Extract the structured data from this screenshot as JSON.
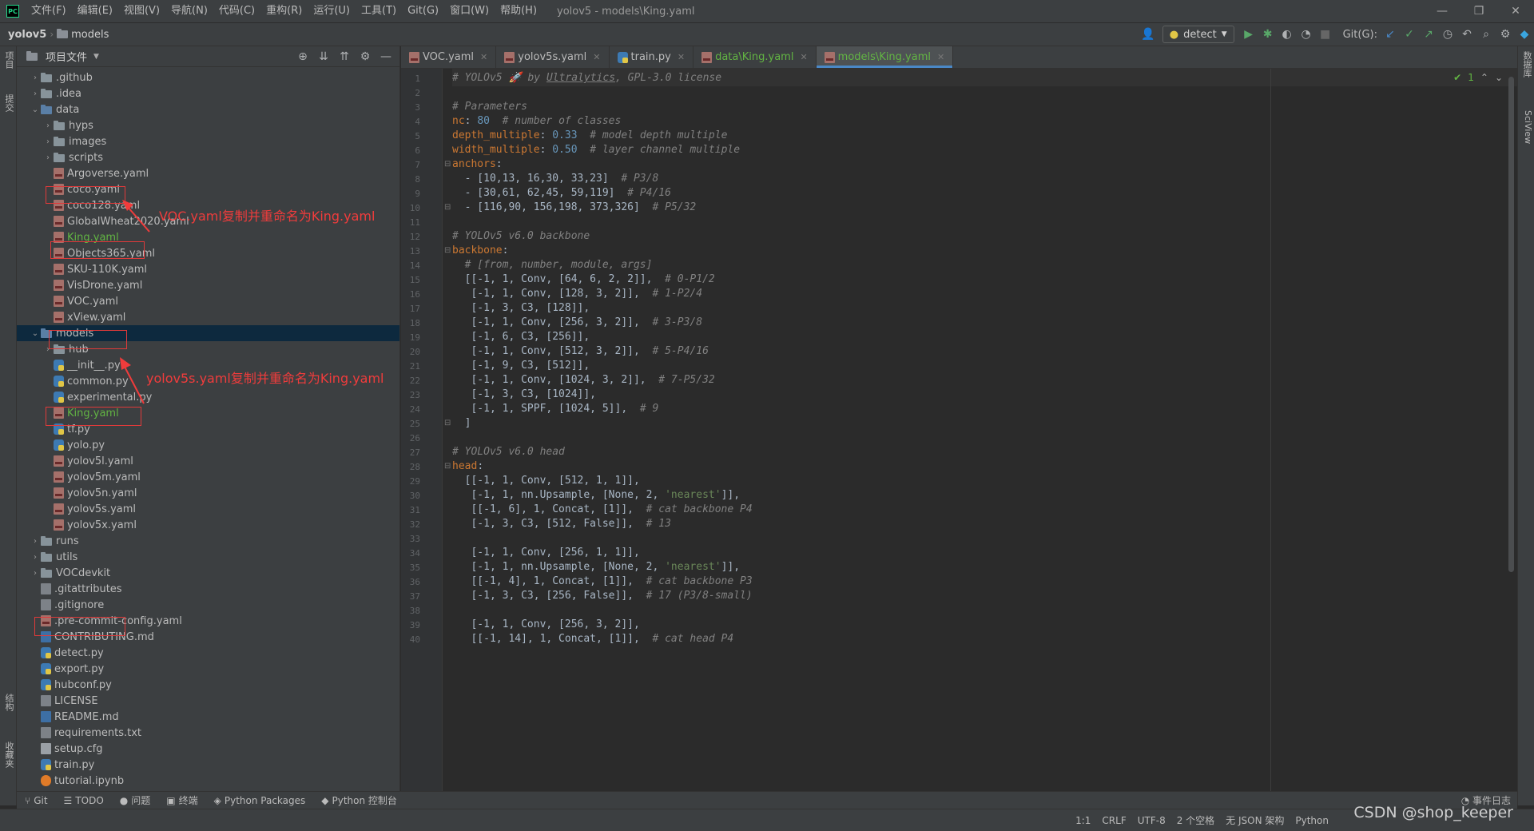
{
  "app": {
    "logo": "PC",
    "window_title": "yolov5 - models\\King.yaml"
  },
  "menu": [
    "文件(F)",
    "编辑(E)",
    "视图(V)",
    "导航(N)",
    "代码(C)",
    "重构(R)",
    "运行(U)",
    "工具(T)",
    "Git(G)",
    "窗口(W)",
    "帮助(H)"
  ],
  "window_controls": {
    "minimize": "—",
    "restore": "❐",
    "close": "✕"
  },
  "breadcrumb": {
    "project": "yolov5",
    "separator": "›",
    "folder": "models"
  },
  "toolbar": {
    "run_config": "detect",
    "git_label": "Git(G):"
  },
  "left_stripe": {
    "project": "项目",
    "commit": "提交",
    "structure": "结构",
    "favorites": "收藏夹"
  },
  "right_stripe": {
    "database": "数据库",
    "sciview": "SciView"
  },
  "project_panel": {
    "title": "项目文件"
  },
  "tree": [
    {
      "name": ".github",
      "type": "dir",
      "depth": 1,
      "expanded": false
    },
    {
      "name": ".idea",
      "type": "dir",
      "depth": 1,
      "expanded": false
    },
    {
      "name": "data",
      "type": "dir",
      "depth": 1,
      "expanded": true
    },
    {
      "name": "hyps",
      "type": "dir",
      "depth": 2,
      "expanded": false
    },
    {
      "name": "images",
      "type": "dir",
      "depth": 2,
      "expanded": false
    },
    {
      "name": "scripts",
      "type": "dir",
      "depth": 2,
      "expanded": false
    },
    {
      "name": "Argoverse.yaml",
      "type": "yaml",
      "depth": 2
    },
    {
      "name": "coco.yaml",
      "type": "yaml",
      "depth": 2
    },
    {
      "name": "coco128.yaml",
      "type": "yaml",
      "depth": 2
    },
    {
      "name": "GlobalWheat2020.yaml",
      "type": "yaml",
      "depth": 2
    },
    {
      "name": "King.yaml",
      "type": "yaml",
      "depth": 2,
      "new": true
    },
    {
      "name": "Objects365.yaml",
      "type": "yaml",
      "depth": 2
    },
    {
      "name": "SKU-110K.yaml",
      "type": "yaml",
      "depth": 2
    },
    {
      "name": "VisDrone.yaml",
      "type": "yaml",
      "depth": 2
    },
    {
      "name": "VOC.yaml",
      "type": "yaml",
      "depth": 2
    },
    {
      "name": "xView.yaml",
      "type": "yaml",
      "depth": 2
    },
    {
      "name": "models",
      "type": "dir",
      "depth": 1,
      "expanded": true,
      "selected": true
    },
    {
      "name": "hub",
      "type": "dir",
      "depth": 2,
      "expanded": false
    },
    {
      "name": "__init__.py",
      "type": "py",
      "depth": 2
    },
    {
      "name": "common.py",
      "type": "py",
      "depth": 2
    },
    {
      "name": "experimental.py",
      "type": "py",
      "depth": 2
    },
    {
      "name": "King.yaml",
      "type": "yaml",
      "depth": 2,
      "new": true
    },
    {
      "name": "tf.py",
      "type": "py",
      "depth": 2
    },
    {
      "name": "yolo.py",
      "type": "py",
      "depth": 2
    },
    {
      "name": "yolov5l.yaml",
      "type": "yaml",
      "depth": 2
    },
    {
      "name": "yolov5m.yaml",
      "type": "yaml",
      "depth": 2
    },
    {
      "name": "yolov5n.yaml",
      "type": "yaml",
      "depth": 2
    },
    {
      "name": "yolov5s.yaml",
      "type": "yaml",
      "depth": 2
    },
    {
      "name": "yolov5x.yaml",
      "type": "yaml",
      "depth": 2
    },
    {
      "name": "runs",
      "type": "dir",
      "depth": 1,
      "expanded": false
    },
    {
      "name": "utils",
      "type": "dir",
      "depth": 1,
      "expanded": false
    },
    {
      "name": "VOCdevkit",
      "type": "dir",
      "depth": 1,
      "expanded": false
    },
    {
      "name": ".gitattributes",
      "type": "txt",
      "depth": 1
    },
    {
      "name": ".gitignore",
      "type": "txt",
      "depth": 1
    },
    {
      "name": ".pre-commit-config.yaml",
      "type": "yaml",
      "depth": 1
    },
    {
      "name": "CONTRIBUTING.md",
      "type": "md",
      "depth": 1
    },
    {
      "name": "detect.py",
      "type": "py",
      "depth": 1
    },
    {
      "name": "export.py",
      "type": "py",
      "depth": 1
    },
    {
      "name": "hubconf.py",
      "type": "py",
      "depth": 1
    },
    {
      "name": "LICENSE",
      "type": "txt",
      "depth": 1
    },
    {
      "name": "README.md",
      "type": "md",
      "depth": 1
    },
    {
      "name": "requirements.txt",
      "type": "txt",
      "depth": 1
    },
    {
      "name": "setup.cfg",
      "type": "cfg",
      "depth": 1
    },
    {
      "name": "train.py",
      "type": "py",
      "depth": 1
    },
    {
      "name": "tutorial.ipynb",
      "type": "nb",
      "depth": 1
    }
  ],
  "annotations": {
    "voc": "VOC.yaml复制并重命名为King.yaml",
    "yolov5s": "yolov5s.yaml复制并重命名为King.yaml",
    "color": "#f03c3c"
  },
  "tabs": [
    {
      "label": "VOC.yaml",
      "type": "yaml",
      "active": false
    },
    {
      "label": "yolov5s.yaml",
      "type": "yaml",
      "active": false
    },
    {
      "label": "train.py",
      "type": "py",
      "active": false
    },
    {
      "label": "data\\King.yaml",
      "type": "yaml",
      "active": false,
      "green": true
    },
    {
      "label": "models\\King.yaml",
      "type": "yaml",
      "active": true,
      "green": true
    }
  ],
  "inspection": {
    "count": "1",
    "up": "⌃",
    "down": "⌄"
  },
  "code": [
    [
      [
        "c",
        "# YOLOv5 🚀 by "
      ],
      [
        "cl",
        "Ultralytics"
      ],
      [
        "c",
        ", GPL-3.0 license"
      ]
    ],
    [],
    [
      [
        "c",
        "# Parameters"
      ]
    ],
    [
      [
        "k",
        "nc"
      ],
      [
        "t",
        ": "
      ],
      [
        "n",
        "80"
      ],
      [
        "t",
        "  "
      ],
      [
        "c",
        "# number of classes"
      ]
    ],
    [
      [
        "k",
        "depth_multiple"
      ],
      [
        "t",
        ": "
      ],
      [
        "n",
        "0.33"
      ],
      [
        "t",
        "  "
      ],
      [
        "c",
        "# model depth multiple"
      ]
    ],
    [
      [
        "k",
        "width_multiple"
      ],
      [
        "t",
        ": "
      ],
      [
        "n",
        "0.50"
      ],
      [
        "t",
        "  "
      ],
      [
        "c",
        "# layer channel multiple"
      ]
    ],
    [
      [
        "k",
        "anchors"
      ],
      [
        "t",
        ":"
      ]
    ],
    [
      [
        "t",
        "  - [10,13, 16,30, 33,23]  "
      ],
      [
        "c",
        "# P3/8"
      ]
    ],
    [
      [
        "t",
        "  - [30,61, 62,45, 59,119]  "
      ],
      [
        "c",
        "# P4/16"
      ]
    ],
    [
      [
        "t",
        "  - [116,90, 156,198, 373,326]  "
      ],
      [
        "c",
        "# P5/32"
      ]
    ],
    [],
    [
      [
        "c",
        "# YOLOv5 v6.0 backbone"
      ]
    ],
    [
      [
        "k",
        "backbone"
      ],
      [
        "t",
        ":"
      ]
    ],
    [
      [
        "t",
        "  "
      ],
      [
        "c",
        "# [from, number, module, args]"
      ]
    ],
    [
      [
        "t",
        "  [[-1, 1, Conv, [64, 6, 2, 2]],  "
      ],
      [
        "c",
        "# 0-P1/2"
      ]
    ],
    [
      [
        "t",
        "   [-1, 1, Conv, [128, 3, 2]],  "
      ],
      [
        "c",
        "# 1-P2/4"
      ]
    ],
    [
      [
        "t",
        "   [-1, 3, C3, [128]],"
      ]
    ],
    [
      [
        "t",
        "   [-1, 1, Conv, [256, 3, 2]],  "
      ],
      [
        "c",
        "# 3-P3/8"
      ]
    ],
    [
      [
        "t",
        "   [-1, 6, C3, [256]],"
      ]
    ],
    [
      [
        "t",
        "   [-1, 1, Conv, [512, 3, 2]],  "
      ],
      [
        "c",
        "# 5-P4/16"
      ]
    ],
    [
      [
        "t",
        "   [-1, 9, C3, [512]],"
      ]
    ],
    [
      [
        "t",
        "   [-1, 1, Conv, [1024, 3, 2]],  "
      ],
      [
        "c",
        "# 7-P5/32"
      ]
    ],
    [
      [
        "t",
        "   [-1, 3, C3, [1024]],"
      ]
    ],
    [
      [
        "t",
        "   [-1, 1, SPPF, [1024, 5]],  "
      ],
      [
        "c",
        "# 9"
      ]
    ],
    [
      [
        "t",
        "  ]"
      ]
    ],
    [],
    [
      [
        "c",
        "# YOLOv5 v6.0 head"
      ]
    ],
    [
      [
        "k",
        "head"
      ],
      [
        "t",
        ":"
      ]
    ],
    [
      [
        "t",
        "  [[-1, 1, Conv, [512, 1, 1]],"
      ]
    ],
    [
      [
        "t",
        "   [-1, 1, nn.Upsample, [None, 2, "
      ],
      [
        "s",
        "'nearest'"
      ],
      [
        "t",
        "]],"
      ]
    ],
    [
      [
        "t",
        "   [[-1, 6], 1, Concat, [1]],  "
      ],
      [
        "c",
        "# cat backbone P4"
      ]
    ],
    [
      [
        "t",
        "   [-1, 3, C3, [512, False]],  "
      ],
      [
        "c",
        "# 13"
      ]
    ],
    [],
    [
      [
        "t",
        "   [-1, 1, Conv, [256, 1, 1]],"
      ]
    ],
    [
      [
        "t",
        "   [-1, 1, nn.Upsample, [None, 2, "
      ],
      [
        "s",
        "'nearest'"
      ],
      [
        "t",
        "]],"
      ]
    ],
    [
      [
        "t",
        "   [[-1, 4], 1, Concat, [1]],  "
      ],
      [
        "c",
        "# cat backbone P3"
      ]
    ],
    [
      [
        "t",
        "   [-1, 3, C3, [256, False]],  "
      ],
      [
        "c",
        "# 17 (P3/8-small)"
      ]
    ],
    [],
    [
      [
        "t",
        "   [-1, 1, Conv, [256, 3, 2]],"
      ]
    ],
    [
      [
        "t",
        "   [[-1, 14], 1, Concat, [1]],  "
      ],
      [
        "c",
        "# cat head P4"
      ]
    ]
  ],
  "fold_lines": [
    7,
    10,
    13,
    25,
    28
  ],
  "bottom_tools": [
    {
      "icon": "git-icon",
      "glyph": "⑂",
      "label": "Git"
    },
    {
      "icon": "todo-icon",
      "glyph": "☰",
      "label": "TODO"
    },
    {
      "icon": "problems-icon",
      "glyph": "●",
      "label": "问题"
    },
    {
      "icon": "terminal-icon",
      "glyph": "▣",
      "label": "终端"
    },
    {
      "icon": "packages-icon",
      "glyph": "◈",
      "label": "Python Packages"
    },
    {
      "icon": "console-icon",
      "glyph": "◆",
      "label": "Python 控制台"
    }
  ],
  "event_log": "事件日志",
  "status": {
    "position": "1:1",
    "line_sep": "CRLF",
    "encoding": "UTF-8",
    "indent": "2 个空格",
    "schema": "无 JSON 架构",
    "interpreter": "Python"
  },
  "watermark": "CSDN @shop_keeper"
}
